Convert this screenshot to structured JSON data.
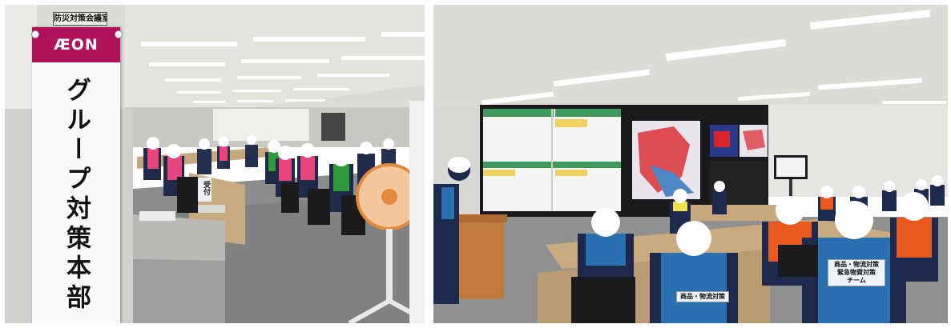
{
  "left_photo": {
    "room_tag": "防災対策会議室",
    "sign_logo": "ÆON",
    "sign_title": "グループ対策本部",
    "reception_card": "受付"
  },
  "right_photo": {
    "vest_label_center": "商品・物流対策",
    "vest_label_right": "商品・物流対策\n緊急物資対策\nチーム"
  },
  "colors": {
    "brand_magenta": "#b0125a",
    "vest_pink": "#e8457a",
    "vest_green": "#2f9a3c",
    "vest_orange": "#e85a1c",
    "vest_blue": "#2a6fb0",
    "carpet": "#8a8c8e",
    "ceiling": "#dcdbd6"
  }
}
